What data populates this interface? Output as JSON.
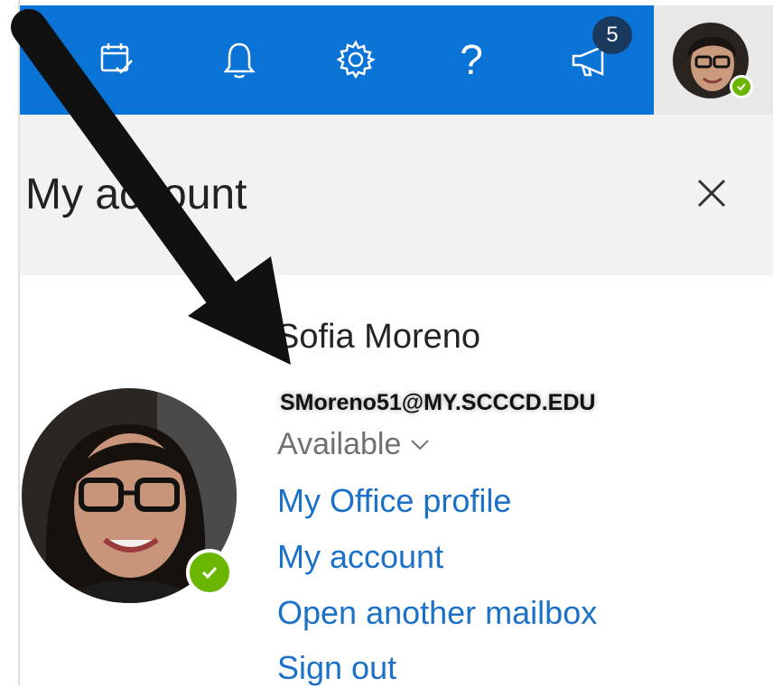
{
  "topbar": {
    "color": "#0a73d6",
    "icons": [
      "calendar-check-icon",
      "bell-icon",
      "gear-icon",
      "help-icon",
      "megaphone-icon"
    ],
    "help_label": "?",
    "notification_count": "5"
  },
  "panel": {
    "title": "My account",
    "close_icon": "close-icon"
  },
  "user": {
    "name": "Sofia Moreno",
    "email": "SMoreno51@MY.SCCCD.EDU",
    "status": "Available",
    "status_color": "#6bb700"
  },
  "links": [
    "My Office profile",
    "My account",
    "Open another mailbox",
    "Sign out"
  ],
  "colors": {
    "link": "#1b71c7",
    "header_band": "#f3f2f1",
    "badge": "#193a5e"
  }
}
